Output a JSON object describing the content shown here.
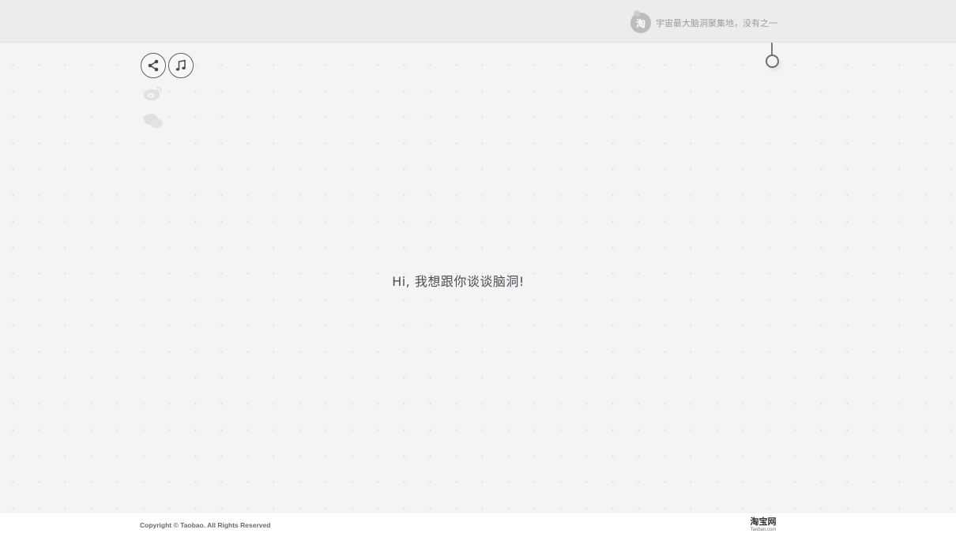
{
  "header": {
    "logo_glyph": "淘",
    "tagline": "宇宙最大脑洞聚集地，没有之一"
  },
  "social": {
    "share_icon": "share-icon",
    "music_icon": "music-note-icon",
    "weibo_icon": "weibo-icon",
    "wechat_icon": "wechat-icon"
  },
  "main": {
    "greeting": "Hi, 我想跟你谈谈脑洞!"
  },
  "footer": {
    "copyright": "Copyright © Taobao. All Rights Reserved",
    "logo_cn": "淘宝网",
    "logo_en": "Taobao.com"
  },
  "colors": {
    "background": "#f4f4f4",
    "header_band": "#ececec",
    "text_dark": "#4a4e56",
    "icon_stroke": "#5a5a5a"
  }
}
